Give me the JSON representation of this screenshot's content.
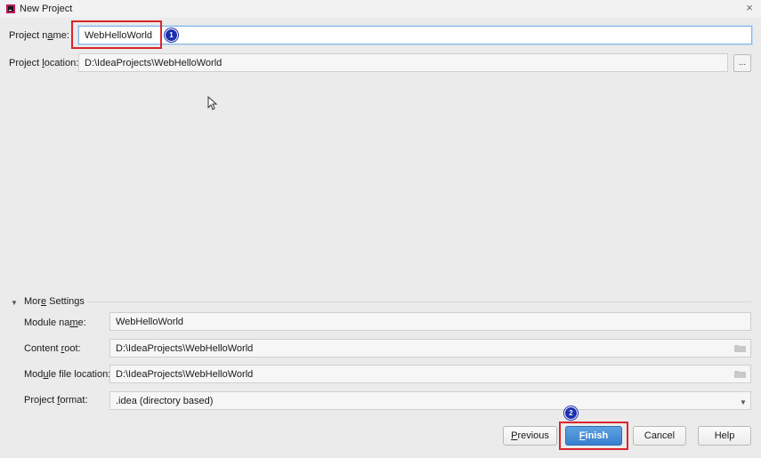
{
  "window": {
    "title": "New Project",
    "close_symbol": "×"
  },
  "form": {
    "project_name": {
      "label_before": "Project n",
      "label_accel": "a",
      "label_after": "me:",
      "value": "WebHelloWorld"
    },
    "project_location": {
      "label_before": "Project ",
      "label_accel": "l",
      "label_after": "ocation:",
      "value": "D:\\IdeaProjects\\WebHelloWorld",
      "browse_label": "..."
    }
  },
  "more_settings": {
    "title_before": "Mor",
    "title_accel": "e",
    "title_after": " Settings",
    "module_name": {
      "label_before": "Module na",
      "label_accel": "m",
      "label_after": "e:",
      "value": "WebHelloWorld"
    },
    "content_root": {
      "label_before": "Content ",
      "label_accel": "r",
      "label_after": "oot:",
      "value": "D:\\IdeaProjects\\WebHelloWorld"
    },
    "module_file_location": {
      "label_before": "Mod",
      "label_accel": "u",
      "label_after": "le file location:",
      "value": "D:\\IdeaProjects\\WebHelloWorld"
    },
    "project_format": {
      "label_before": "Project ",
      "label_accel": "f",
      "label_after": "ormat:",
      "value": ".idea (directory based)"
    }
  },
  "buttons": {
    "previous": {
      "accel": "P",
      "rest": "revious"
    },
    "finish": {
      "accel": "F",
      "rest": "inish"
    },
    "cancel": "Cancel",
    "help": "Help"
  },
  "annotations": {
    "badge_1": "1",
    "badge_2": "2"
  },
  "colors": {
    "highlight": "#d9252c",
    "badge": "#1b2fae",
    "primary_button": "#3a7fcf"
  }
}
